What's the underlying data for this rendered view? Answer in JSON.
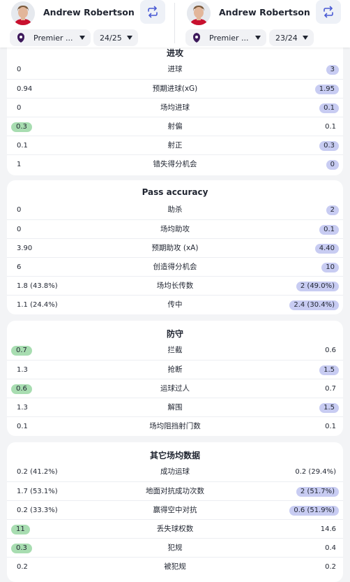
{
  "players": [
    {
      "name": "Andrew Robertson",
      "league": "Premier ...",
      "season": "24/25"
    },
    {
      "name": "Andrew Robertson",
      "league": "Premier ...",
      "season": "23/24"
    }
  ],
  "sections": [
    {
      "title": "进攻",
      "rows": [
        {
          "label": "进球",
          "left": "0",
          "right": "3",
          "highlight": "right"
        },
        {
          "label": "预期进球(xG)",
          "left": "0.94",
          "right": "1.95",
          "highlight": "right"
        },
        {
          "label": "场均进球",
          "left": "0",
          "right": "0.1",
          "highlight": "right"
        },
        {
          "label": "射偏",
          "left": "0.3",
          "right": "0.1",
          "highlight": "left"
        },
        {
          "label": "射正",
          "left": "0.1",
          "right": "0.3",
          "highlight": "right"
        },
        {
          "label": "错失得分机会",
          "left": "1",
          "right": "0",
          "highlight": "right"
        }
      ]
    },
    {
      "title": "Pass accuracy",
      "rows": [
        {
          "label": "助杀",
          "left": "0",
          "right": "2",
          "highlight": "right"
        },
        {
          "label": "场均助攻",
          "left": "0",
          "right": "0.1",
          "highlight": "right"
        },
        {
          "label": "预期助攻 (xA)",
          "left": "3.90",
          "right": "4.40",
          "highlight": "right"
        },
        {
          "label": "创造得分机会",
          "left": "6",
          "right": "10",
          "highlight": "right"
        },
        {
          "label": "场均长传数",
          "left": "1.8 (43.8%)",
          "right": "2 (49.0%)",
          "highlight": "right"
        },
        {
          "label": "传中",
          "left": "1.1 (24.4%)",
          "right": "2.4 (30.4%)",
          "highlight": "right"
        }
      ]
    },
    {
      "title": "防守",
      "rows": [
        {
          "label": "拦截",
          "left": "0.7",
          "right": "0.6",
          "highlight": "left"
        },
        {
          "label": "抢断",
          "left": "1.3",
          "right": "1.5",
          "highlight": "right"
        },
        {
          "label": "运球过人",
          "left": "0.6",
          "right": "0.7",
          "highlight": "left"
        },
        {
          "label": "解围",
          "left": "1.3",
          "right": "1.5",
          "highlight": "right"
        },
        {
          "label": "场均阻挡射门数",
          "left": "0.1",
          "right": "0.1",
          "highlight": "none"
        }
      ]
    },
    {
      "title": "其它场均数据",
      "rows": [
        {
          "label": "成功运球",
          "left": "0.2 (41.2%)",
          "right": "0.2 (29.4%)",
          "highlight": "none"
        },
        {
          "label": "地面对抗成功次数",
          "left": "1.7 (53.1%)",
          "right": "2 (51.7%)",
          "highlight": "right"
        },
        {
          "label": "赢得空中对抗",
          "left": "0.2 (33.3%)",
          "right": "0.6 (51.9%)",
          "highlight": "right"
        },
        {
          "label": "丢失球权数",
          "left": "11",
          "right": "14.6",
          "highlight": "left"
        },
        {
          "label": "犯规",
          "left": "0.3",
          "right": "0.4",
          "highlight": "left"
        },
        {
          "label": "被犯规",
          "left": "0.2",
          "right": "0.2",
          "highlight": "none"
        }
      ]
    }
  ],
  "colors": {
    "left_highlight": "#a8ddb1",
    "right_highlight": "#c8ccf2",
    "accent": "#4a5bd4"
  }
}
